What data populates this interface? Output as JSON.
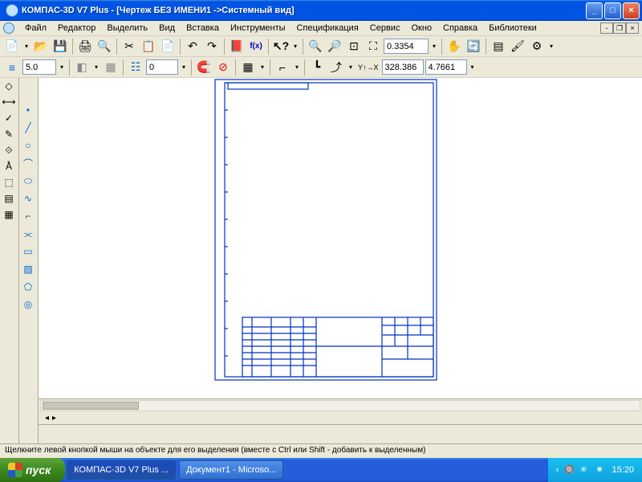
{
  "title": "КОМПАС-3D V7 Plus - [Чертеж БЕЗ ИМЕНИ1 ->Системный вид]",
  "menu": [
    "Файл",
    "Редактор",
    "Выделить",
    "Вид",
    "Вставка",
    "Инструменты",
    "Спецификация",
    "Сервис",
    "Окно",
    "Справка",
    "Библиотеки"
  ],
  "toolbar1": {
    "zoom_val": "0.3354"
  },
  "toolbar2": {
    "spin1": "5.0",
    "spin2": "0",
    "coord_x": "328.386",
    "coord_y": "4.7661"
  },
  "status": "Щелкните левой кнопкой мыши на объекте для его выделения (вместе с Ctrl или Shift - добавить к выделенным)",
  "taskbar": {
    "start": "пуск",
    "tasks": [
      "КОМПАС-3D V7 Plus ...",
      "Документ1 - Microso..."
    ],
    "clock": "15:20"
  }
}
